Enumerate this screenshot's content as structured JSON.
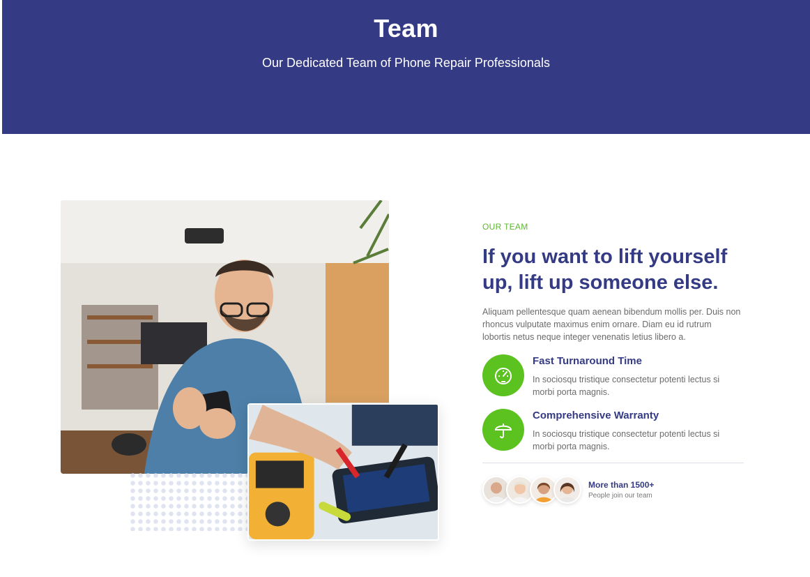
{
  "hero": {
    "title": "Team",
    "subtitle": "Our Dedicated Team of Phone Repair Professionals",
    "background": "#343a84"
  },
  "about": {
    "eyebrow": "OUR TEAM",
    "heading": "If you want to lift yourself up, lift up someone else.",
    "paragraph": "Aliquam pellentesque quam aenean bibendum mollis per. Duis non rhoncus vulputate maximus enim ornare. Diam eu id rutrum lobortis netus neque integer venenatis letius libero a.",
    "features": [
      {
        "icon": "speedometer-icon",
        "title": "Fast Turnaround Time",
        "description": "In sociosqu tristique consectetur potenti lectus si morbi porta magnis."
      },
      {
        "icon": "umbrella-icon",
        "title": "Comprehensive Warranty",
        "description": "In sociosqu tristique consectetur potenti lectus si morbi porta magnis."
      }
    ],
    "team": {
      "count": "More than 1500+",
      "note": "People join our team"
    }
  },
  "colors": {
    "brand": "#343a84",
    "accent": "#5cc21f",
    "eyebrow": "#5cb82e"
  }
}
